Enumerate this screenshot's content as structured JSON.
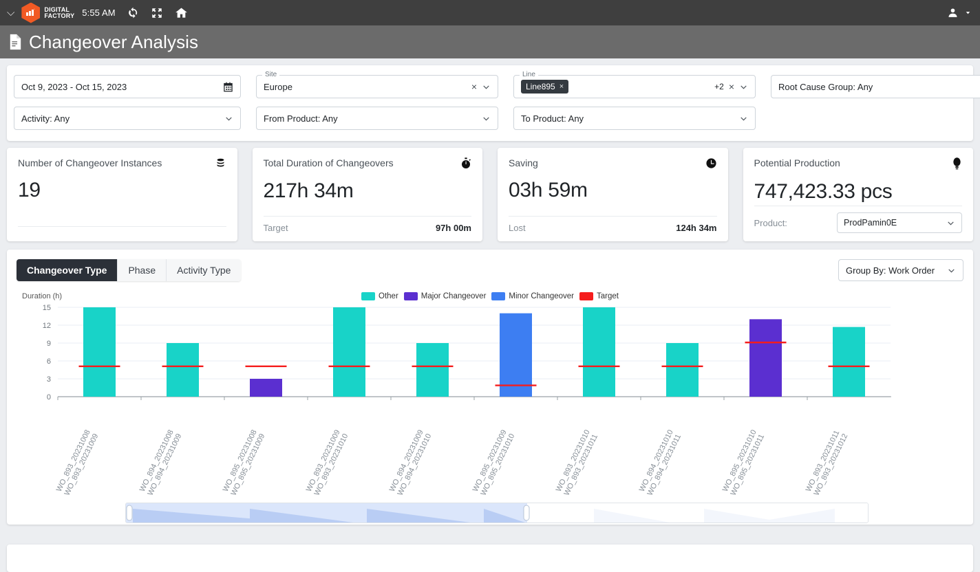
{
  "topbar": {
    "collapse_icon": "chevron-down-icon",
    "brand_line1": "DIGITAL",
    "brand_line2": "FACTORY",
    "time": "5:55 AM",
    "refresh_icon": "refresh-icon",
    "fullscreen_icon": "fullscreen-icon",
    "home_icon": "home-icon",
    "user_icon": "user-icon",
    "user_chevron": "chevron-down-icon"
  },
  "page": {
    "icon": "document-icon",
    "title": "Changeover Analysis"
  },
  "filters": {
    "date_range": {
      "value": "Oct 9, 2023 - Oct 15, 2023",
      "icon": "calendar-icon"
    },
    "site": {
      "label": "Site",
      "value": "Europe",
      "clear": "×",
      "chevron": "chevron-down-icon"
    },
    "line": {
      "label": "Line",
      "chip": "Line895",
      "chip_close": "×",
      "extra": "+2",
      "clear": "×",
      "chevron": "chevron-down-icon"
    },
    "root_cause_group": {
      "value": "Root Cause Group: Any",
      "chevron": "chevron-down-icon"
    },
    "activity": {
      "value": "Activity: Any",
      "chevron": "chevron-down-icon"
    },
    "from_product": {
      "value": "From Product: Any",
      "chevron": "chevron-down-icon"
    },
    "to_product": {
      "value": "To Product: Any",
      "chevron": "chevron-down-icon"
    }
  },
  "kpis": [
    {
      "title": "Number of Changeover Instances",
      "icon": "database-icon",
      "value": "19",
      "foot_label": "",
      "foot_value": ""
    },
    {
      "title": "Total Duration of Changeovers",
      "icon": "stopwatch-icon",
      "value": "217h 34m",
      "foot_label": "Target",
      "foot_value": "97h 00m"
    },
    {
      "title": "Saving",
      "icon": "clock-icon",
      "value": "03h 59m",
      "foot_label": "Lost",
      "foot_value": "124h 34m"
    },
    {
      "title": "Potential Production",
      "icon": "lightbulb-icon",
      "value": "747,423.33 pcs",
      "foot_label": "Product:",
      "foot_select": "ProdPamin0E",
      "foot_select_chevron": "chevron-down-icon"
    }
  ],
  "chart_panel": {
    "tabs": [
      {
        "label": "Changeover Type",
        "active": true
      },
      {
        "label": "Phase",
        "active": false
      },
      {
        "label": "Activity Type",
        "active": false
      }
    ],
    "group_by": {
      "value": "Group By: Work Order",
      "chevron": "chevron-down-icon"
    }
  },
  "chart_data": {
    "type": "bar",
    "title": "",
    "ylabel": "Duration (h)",
    "xlabel": "",
    "ylim": [
      0,
      15
    ],
    "yticks": [
      0,
      3,
      6,
      9,
      12,
      15
    ],
    "grid": true,
    "legend_position": "top-center",
    "legend": [
      {
        "name": "Other",
        "color": "#18d3c8"
      },
      {
        "name": "Major Changeover",
        "color": "#5b2fd0"
      },
      {
        "name": "Minor Changeover",
        "color": "#3d7ef2"
      },
      {
        "name": "Target",
        "color": "#f51d1d"
      }
    ],
    "categories": [
      "WO_893_20231008\nWO_893_20231009",
      "WO_894_20231008\nWO_894_20231009",
      "WO_895_20231008\nWO_895_20231009",
      "WO_893_20231009\nWO_893_20231010",
      "WO_894_20231009\nWO_894_20231010",
      "WO_895_20231009\nWO_895_20231010",
      "WO_893_20231010\nWO_893_20231011",
      "WO_894_20231010\nWO_894_20231011",
      "WO_895_20231010\nWO_895_20231011",
      "WO_893_20231011\nWO_893_20231012"
    ],
    "values": [
      15.0,
      9.0,
      3.0,
      15.0,
      9.0,
      14.0,
      15.0,
      9.0,
      13.0,
      11.7
    ],
    "bar_types": [
      "Other",
      "Other",
      "Major Changeover",
      "Other",
      "Other",
      "Minor Changeover",
      "Other",
      "Other",
      "Major Changeover",
      "Other"
    ],
    "target": [
      5.1,
      5.1,
      5.1,
      5.1,
      5.1,
      1.9,
      5.1,
      5.1,
      9.1,
      5.1
    ]
  },
  "brush": {
    "selection_start_pct": 0,
    "selection_end_pct": 53,
    "left_handle": "brush-handle-left",
    "right_handle": "brush-handle-right"
  }
}
